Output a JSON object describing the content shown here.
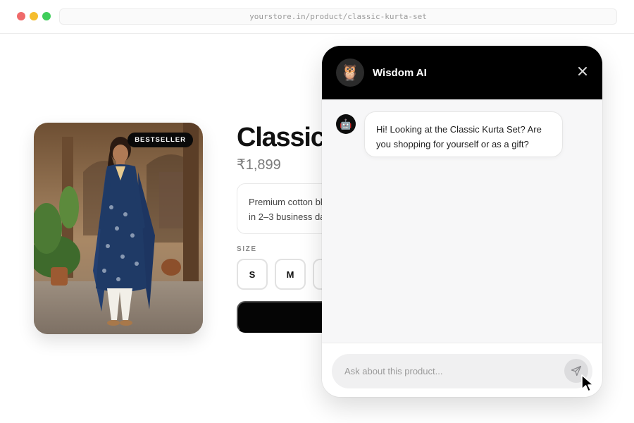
{
  "browser": {
    "url": "yourstore.in/product/classic-kurta-set"
  },
  "product": {
    "badge": "BESTSELLER",
    "title": "Classic",
    "price": "₹1,899",
    "description_lines": [
      "Premium cotton bl",
      "in 2–3 business da"
    ],
    "size_label": "SIZE",
    "sizes": [
      "S",
      "M"
    ]
  },
  "chat": {
    "title": "Wisdom AI",
    "avatar_emoji": "🦉",
    "bot_emoji": "🤖",
    "messages": [
      {
        "from": "bot",
        "text": "Hi! Looking at the Classic Kurta Set? Are you shopping for yourself or as a gift?"
      }
    ],
    "input_placeholder": "Ask about this product..."
  },
  "colors": {
    "header": "#000000",
    "badge": "#0a0a0a",
    "kurta": "#1f3a66",
    "chat_bg": "#f7f7f8"
  },
  "icons": [
    "close-icon",
    "send-icon",
    "owl-icon",
    "robot-icon",
    "cursor-icon"
  ]
}
